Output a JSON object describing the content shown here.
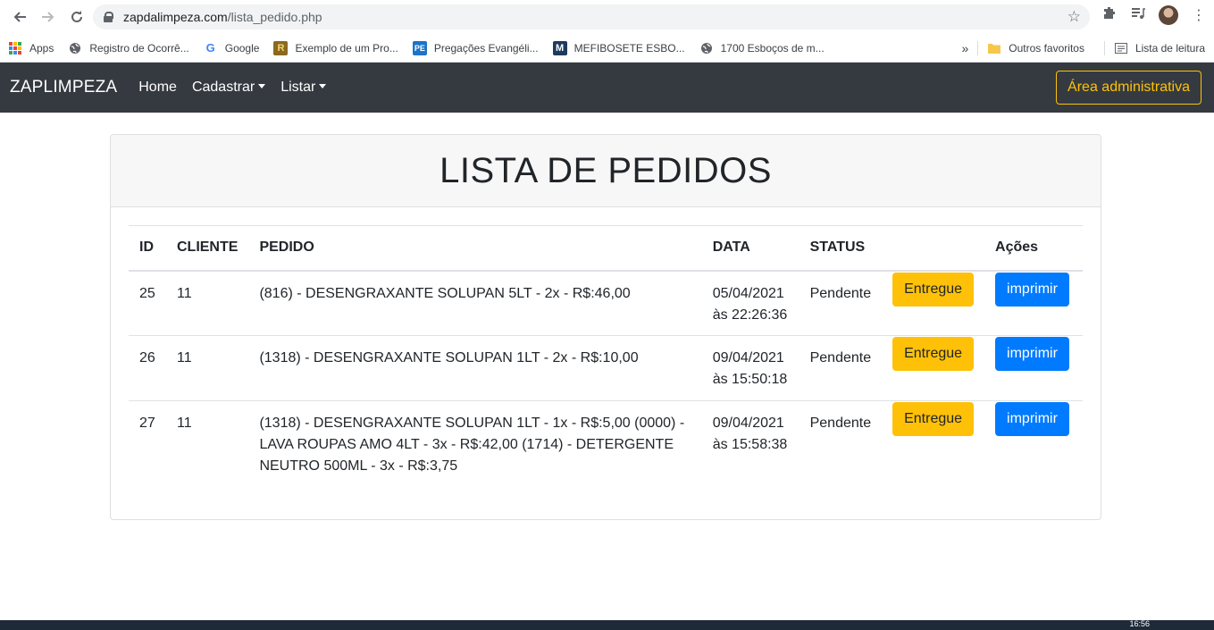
{
  "browser": {
    "url_host": "zapdalimpeza.com",
    "url_path": "/lista_pedido.php",
    "bookmarks": [
      {
        "label": "Apps",
        "icon": "apps-grid-icon"
      },
      {
        "label": "Registro de Ocorrê...",
        "icon": "globe-icon"
      },
      {
        "label": "Google",
        "icon": "google-icon"
      },
      {
        "label": "Exemplo de um Pro...",
        "icon": "r-bookmark-icon"
      },
      {
        "label": "Pregações Evangéli...",
        "icon": "pe-bookmark-icon"
      },
      {
        "label": "MEFIBOSETE ESBO...",
        "icon": "m-bookmark-icon"
      },
      {
        "label": "1700 Esboços de m...",
        "icon": "globe-icon"
      }
    ],
    "more_bookmarks": "»",
    "other_favorites": "Outros favoritos",
    "reading_list": "Lista de leitura"
  },
  "navbar": {
    "brand": "ZAPLIMPEZA",
    "links": [
      "Home",
      "Cadastrar",
      "Listar"
    ],
    "admin_button": "Área administrativa"
  },
  "card": {
    "title": "LISTA DE PEDIDOS"
  },
  "table": {
    "headers": [
      "ID",
      "CLIENTE",
      "PEDIDO",
      "DATA",
      "STATUS",
      "",
      "Ações"
    ],
    "rows": [
      {
        "id": "25",
        "cliente": "11",
        "pedido": "(816) - DESENGRAXANTE SOLUPAN 5LT - 2x - R$:46,00",
        "data_line1": "05/04/2021",
        "data_line2": "às 22:26:36",
        "status": "Pendente",
        "btn_entregue": "Entregue",
        "btn_imprimir": "imprimir"
      },
      {
        "id": "26",
        "cliente": "11",
        "pedido": "(1318) - DESENGRAXANTE SOLUPAN 1LT - 2x - R$:10,00",
        "data_line1": "09/04/2021",
        "data_line2": "às 15:50:18",
        "status": "Pendente",
        "btn_entregue": "Entregue",
        "btn_imprimir": "imprimir"
      },
      {
        "id": "27",
        "cliente": "11",
        "pedido": "(1318) - DESENGRAXANTE SOLUPAN 1LT - 1x - R$:5,00 (0000) - LAVA ROUPAS AMO 4LT - 3x - R$:42,00 (1714) - DETERGENTE NEUTRO 500ML - 3x - R$:3,75",
        "data_line1": "09/04/2021",
        "data_line2": "às 15:58:38",
        "status": "Pendente",
        "btn_entregue": "Entregue",
        "btn_imprimir": "imprimir"
      }
    ]
  },
  "taskbar": {
    "clock": "16:56"
  },
  "colors": {
    "navbar_bg": "#343a40",
    "warning": "#ffc107",
    "primary": "#007bff"
  }
}
